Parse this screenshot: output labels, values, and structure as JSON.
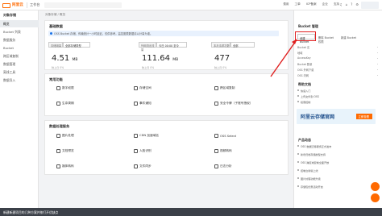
{
  "topbar": {
    "logo_text": "阿里云",
    "home": "工作台",
    "nav": [
      "费用",
      "工单",
      "ICP备案",
      "企业",
      "支持"
    ],
    "icons": [
      "bell-icon",
      "cart-icon",
      "help-icon",
      "settings-icon"
    ],
    "accent": "#ff6a00"
  },
  "sidebar": {
    "title": "对象存储",
    "items": [
      "概览",
      "Bucket 列表",
      "数据服务",
      "Bucket",
      "跨区域复制",
      "数据管理",
      "离线工具",
      "数据导入"
    ]
  },
  "breadcrumb": "对象存储 / 概览",
  "basic": {
    "title": "基础数据",
    "notice": "OSS Bucket 存储、传输统计一小时延迟，仅供参考。监控图表数据请以计量为准。",
    "filters": {
      "storage_label": "存储用量",
      "storage_value": "全部存储类型",
      "flow_label": "外网流出流量",
      "flow_value": "今日 00:00 至今",
      "req_label": "本月请求次数",
      "req_value": "全部"
    },
    "metrics": [
      {
        "value": "4.51",
        "unit": "MB",
        "sub": "较上日 0%"
      },
      {
        "value": "111.64",
        "unit": "MB",
        "sub": "较上月 0%"
      },
      {
        "value": "477",
        "unit": "",
        "sub": "较上月 0%"
      }
    ]
  },
  "common": {
    "title": "常用功能",
    "items": [
      "数字权限",
      "存储空间",
      "跨区域复制",
      "生命周期",
      "事件通知",
      "安全令牌（子账号授权）"
    ]
  },
  "advanced": {
    "title": "数据处理服务",
    "items": [
      "图片处理",
      "CDN 加速域名",
      "OSS Select",
      "文档预览",
      "人脸识别",
      "视频转码",
      "媒体转码",
      "文件同步",
      "日志分析"
    ]
  },
  "right": {
    "header": "Bucket 管理",
    "tabs": [
      "创建 Bucket",
      "删除 Bucket 权限",
      "新建 Bucket"
    ],
    "rows": [
      [
        "Bucket 名",
        "-"
      ],
      [
        "地域",
        "-"
      ],
      [
        "AccessKey",
        "-"
      ],
      [
        "Bucket 数量",
        "-"
      ],
      [
        "OSS 外网下载",
        "-"
      ],
      [
        "OSS 内网",
        "-"
      ]
    ],
    "help_header": "帮助文档",
    "help_items": [
      "快速入门",
      "上传文件到 OSS",
      "权限控制"
    ],
    "ad_title": "阿里云存储官网",
    "ad_button": "立即查看",
    "product_header": "产品动态",
    "product_items": [
      "OSS 数据迁移服务正式发布",
      "新增归档存储类型支持",
      "OSS 跨区域复制全面开放",
      "控制台新版上线",
      "图片处理功能升级",
      "存储包优惠活动开启"
    ]
  },
  "caption": "新建新建项目的几种方案并按打开优缺点"
}
